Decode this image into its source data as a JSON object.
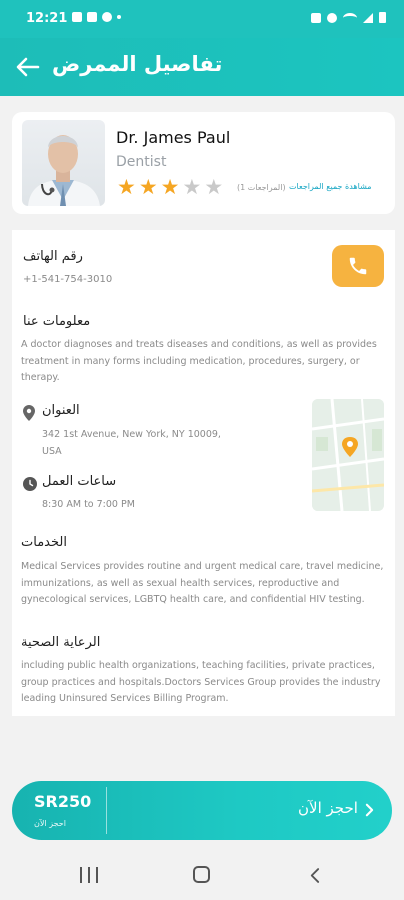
{
  "status_bar": {
    "time": "12:21",
    "icons_left": [
      "image-icon",
      "image-icon",
      "messenger-icon",
      "dot-icon"
    ],
    "icons_right": [
      "alarm-icon",
      "no-sound-icon",
      "wifi-icon",
      "signal-icon",
      "battery-icon"
    ]
  },
  "header": {
    "title": "تفاصيل الممرض",
    "back_icon": "arrow-left-icon",
    "color": "#1fc2bd"
  },
  "doctor": {
    "name": "Dr. James Paul",
    "specialty": "Dentist",
    "rating": 3,
    "rating_max": 5,
    "reviews_count": "(المراجعات 1)",
    "all_reviews_link": "مشاهدة جميع المراجعات"
  },
  "details": {
    "phone_label": "رقم الهاتف",
    "phone": "+1-541-754-3010",
    "about_label": "معلومات عنا",
    "about_text": "A doctor diagnoses and treats diseases and conditions, as well as provides treatment in many forms including medication, procedures, surgery, or therapy.",
    "address_label": "العنوان",
    "address": "342 1st Avenue, New York, NY 10009, USA",
    "hours_label": "ساعات العمل",
    "hours": "8:30 AM to 7:00 PM",
    "services_label": "الخدمات",
    "services_text": "Medical Services provides routine and urgent medical care, travel medicine, immunizations, as well as sexual health services, reproductive and gynecological services, LGBTQ health care, and confidential HIV testing.",
    "healthcare_label": "الرعاية الصحية",
    "healthcare_text": "including public health organizations, teaching facilities, private practices, group practices and hospitals.Doctors Services Group provides the industry leading Uninsured Services Billing Program."
  },
  "booking": {
    "price": "SR250",
    "price_caption": "احجز الآن",
    "button_label": "احجز الآن"
  },
  "colors": {
    "accent": "#1fc2bd",
    "star": "#f5a623",
    "call_button": "#f6b340",
    "link": "#1aa7c4"
  }
}
